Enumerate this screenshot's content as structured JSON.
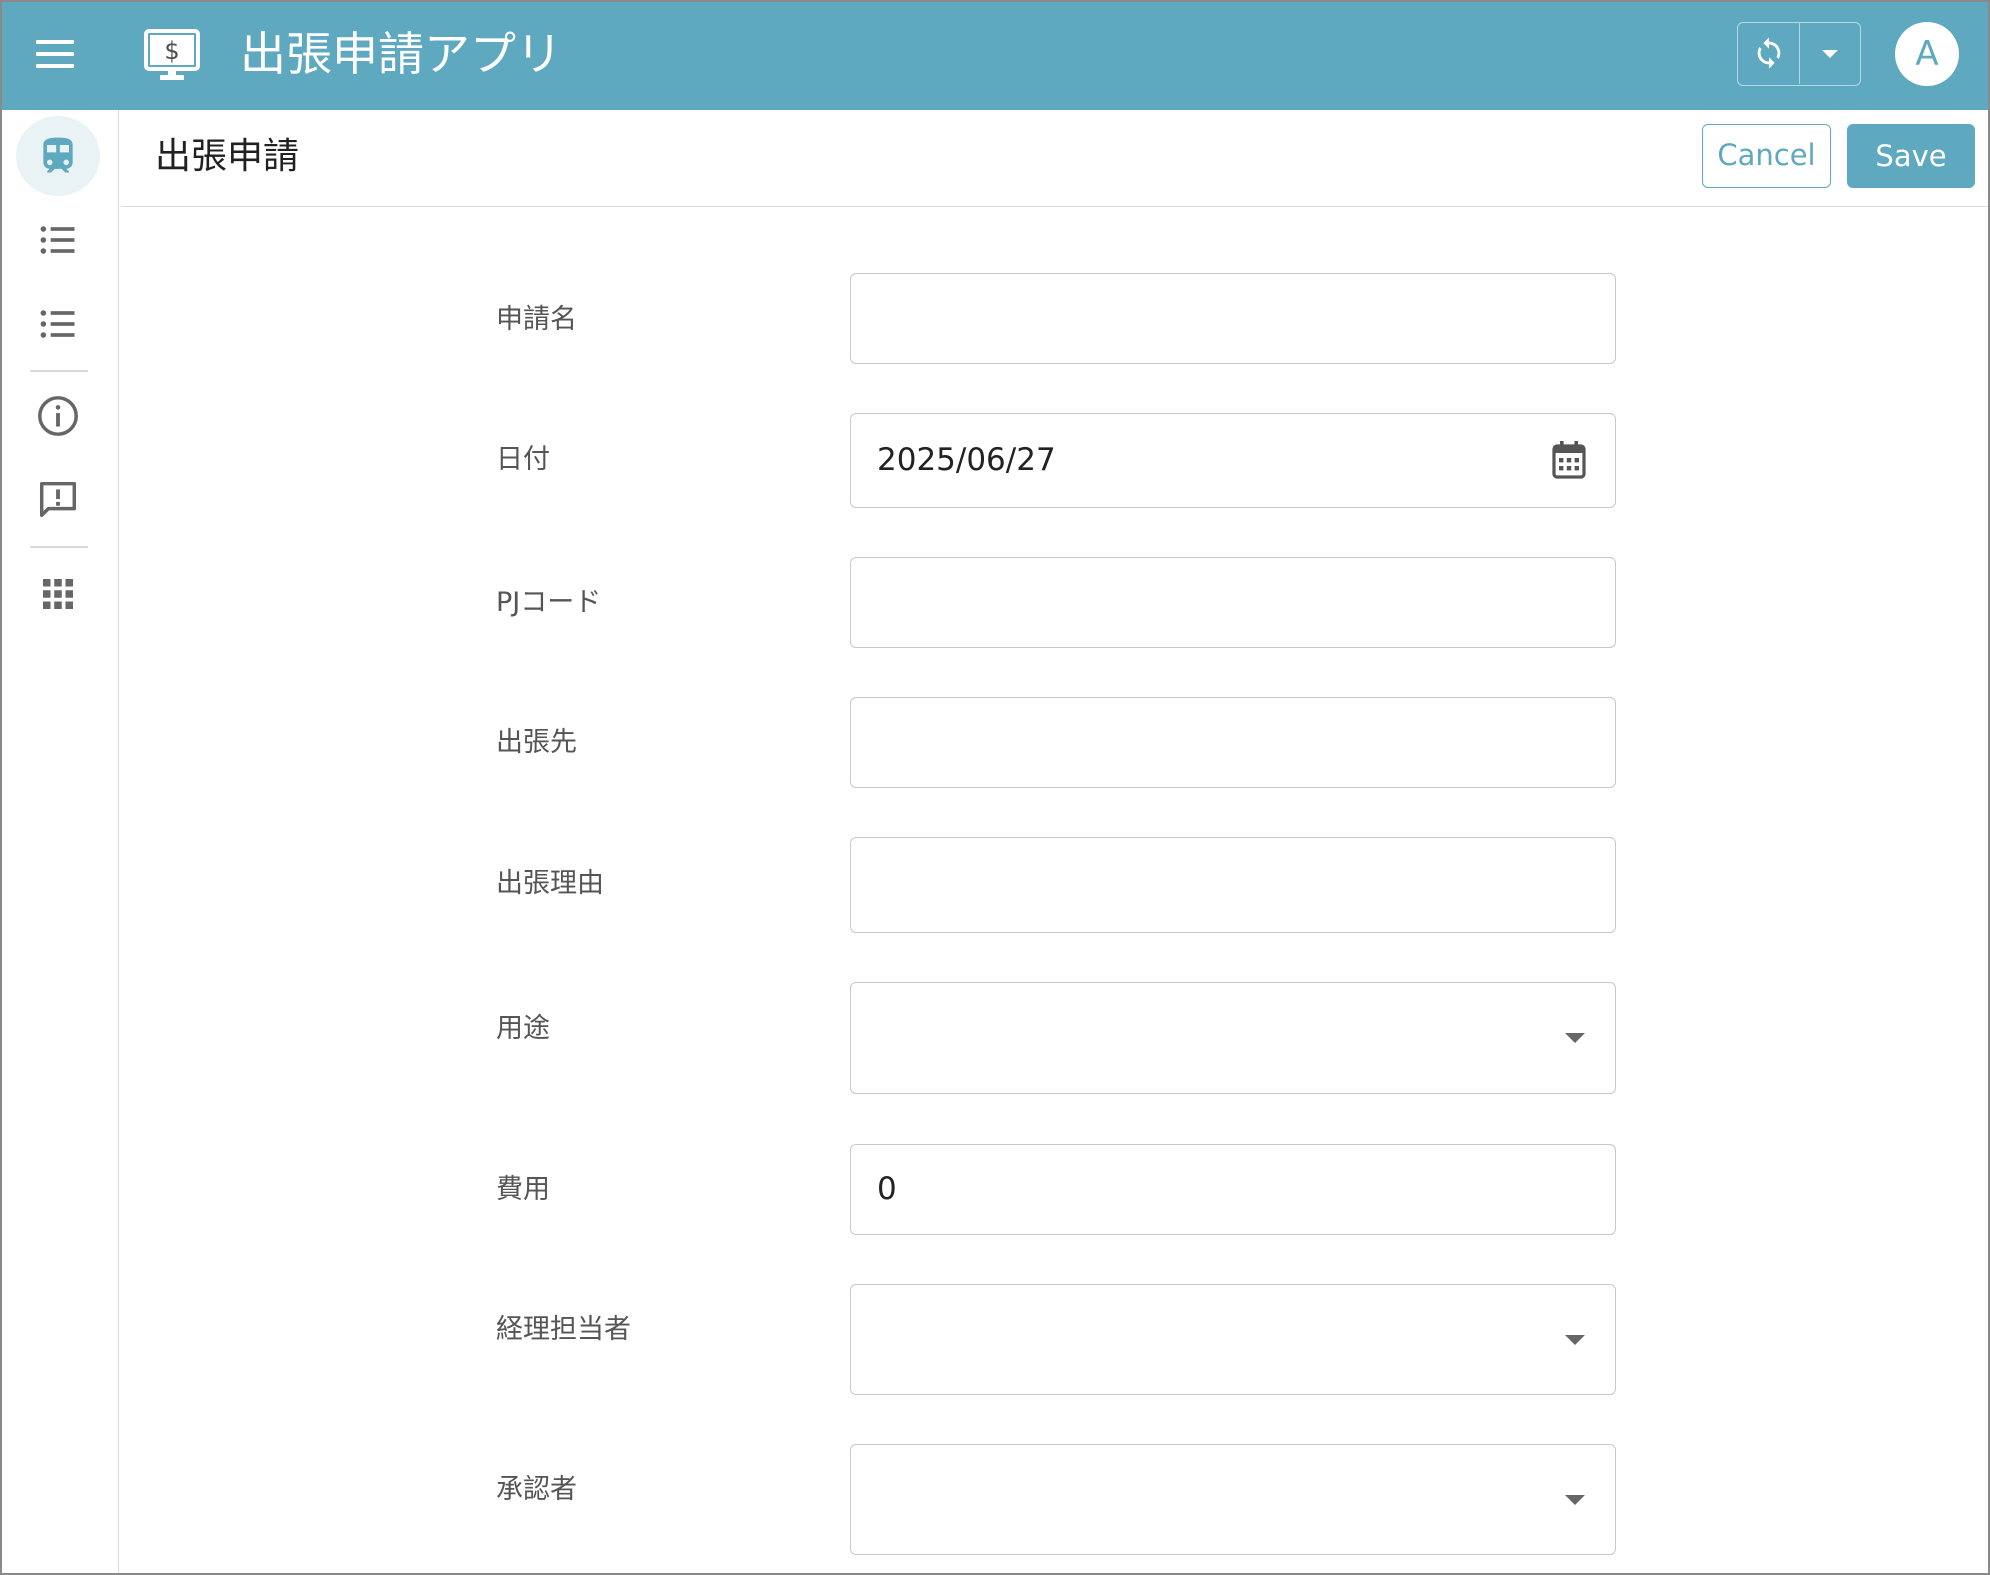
{
  "appbar": {
    "title": "出張申請アプリ",
    "avatar_initial": "A",
    "brand_color": "#5fa9c0",
    "icons": [
      "menu-icon",
      "monitor-dollar-icon",
      "sync-icon",
      "caret-down-icon"
    ]
  },
  "rail": {
    "items": [
      {
        "name": "train-icon",
        "active": true
      },
      {
        "name": "list-icon",
        "active": false
      },
      {
        "name": "list-icon",
        "active": false
      },
      {
        "name": "info-icon",
        "active": false
      },
      {
        "name": "feedback-icon",
        "active": false
      },
      {
        "name": "apps-grid-icon",
        "active": false
      }
    ]
  },
  "page": {
    "title": "出張申請",
    "cancel_label": "Cancel",
    "save_label": "Save"
  },
  "form": {
    "fields": [
      {
        "label": "申請名",
        "value": "",
        "type": "text"
      },
      {
        "label": "日付",
        "value": "2025/06/27",
        "type": "date"
      },
      {
        "label": "PJコード",
        "value": "",
        "type": "text"
      },
      {
        "label": "出張先",
        "value": "",
        "type": "text"
      },
      {
        "label": "出張理由",
        "value": "",
        "type": "text"
      },
      {
        "label": "用途",
        "value": "",
        "type": "select"
      },
      {
        "label": "費用",
        "value": "0",
        "type": "number"
      },
      {
        "label": "経理担当者",
        "value": "",
        "type": "select"
      },
      {
        "label": "承認者",
        "value": "",
        "type": "select"
      }
    ]
  }
}
